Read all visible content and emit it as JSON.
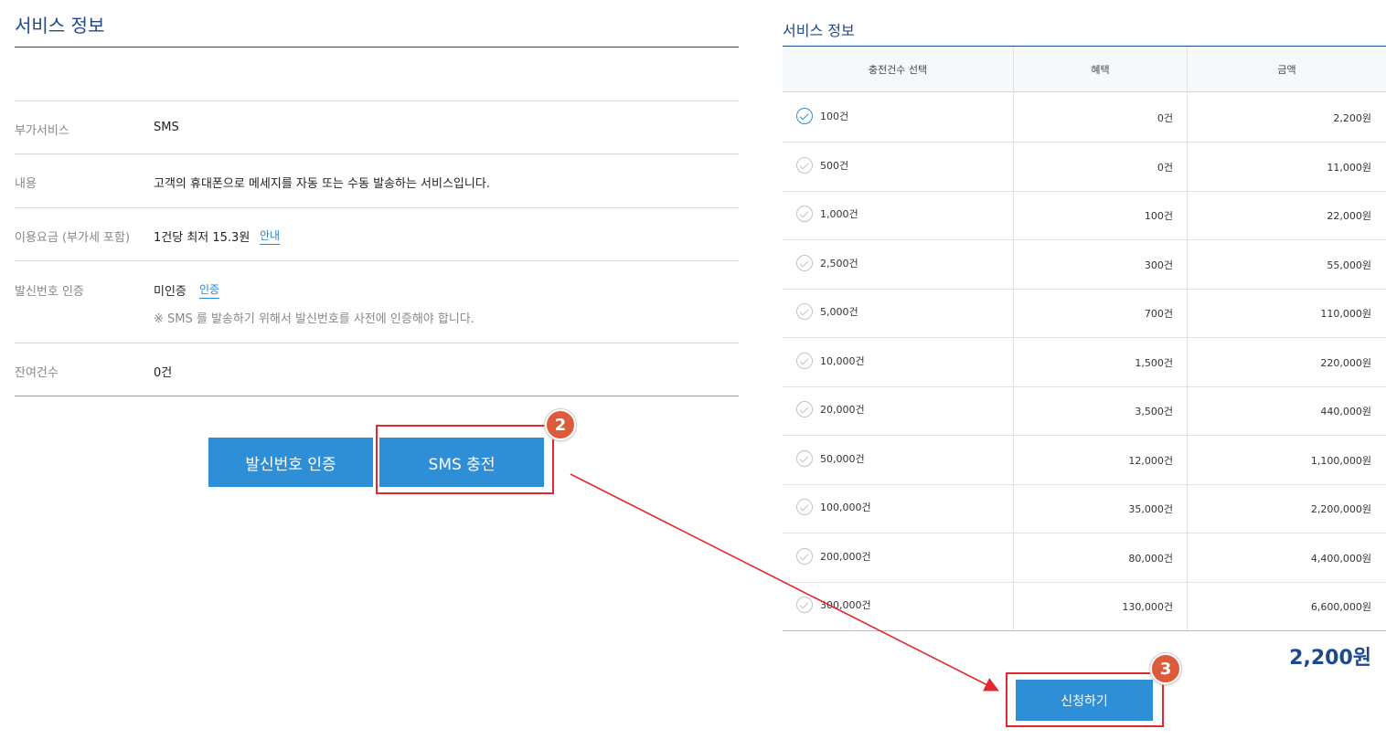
{
  "left": {
    "title": "서비스 정보",
    "rows": [
      {
        "label": "부가서비스",
        "value": "SMS"
      },
      {
        "label": "내용",
        "value": "고객의 휴대폰으로 메세지를 자동 또는 수동 발송하는 서비스입니다."
      },
      {
        "label": "이용요금 (부가세 포함)",
        "value": "1건당 최저 15.3원",
        "link": "안내"
      },
      {
        "label": "발신번호 인증",
        "value": "미인증",
        "link": "인증",
        "note": "※ SMS 를 발송하기 위해서 발신번호를 사전에 인증해야 합니다."
      },
      {
        "label": "잔여건수",
        "value": "0건"
      }
    ],
    "buttons": {
      "verify": "발신번호 인증",
      "charge": "SMS 충전"
    }
  },
  "right": {
    "title": "서비스 정보",
    "headers": [
      "충전건수 선택",
      "혜택",
      "금액"
    ],
    "rows": [
      {
        "count": "100건",
        "benefit": "0건",
        "amount": "2,200원",
        "selected": true
      },
      {
        "count": "500건",
        "benefit": "0건",
        "amount": "11,000원",
        "selected": false
      },
      {
        "count": "1,000건",
        "benefit": "100건",
        "amount": "22,000원",
        "selected": false
      },
      {
        "count": "2,500건",
        "benefit": "300건",
        "amount": "55,000원",
        "selected": false
      },
      {
        "count": "5,000건",
        "benefit": "700건",
        "amount": "110,000원",
        "selected": false
      },
      {
        "count": "10,000건",
        "benefit": "1,500건",
        "amount": "220,000원",
        "selected": false
      },
      {
        "count": "20,000건",
        "benefit": "3,500건",
        "amount": "440,000원",
        "selected": false
      },
      {
        "count": "50,000건",
        "benefit": "12,000건",
        "amount": "1,100,000원",
        "selected": false
      },
      {
        "count": "100,000건",
        "benefit": "35,000건",
        "amount": "2,200,000원",
        "selected": false
      },
      {
        "count": "200,000건",
        "benefit": "80,000건",
        "amount": "4,400,000원",
        "selected": false
      },
      {
        "count": "300,000건",
        "benefit": "130,000건",
        "amount": "6,600,000원",
        "selected": false
      }
    ],
    "total": "2,200원",
    "apply_button": "신청하기"
  },
  "annotations": {
    "step2": "2",
    "step3": "3",
    "color": "#e0282e"
  }
}
